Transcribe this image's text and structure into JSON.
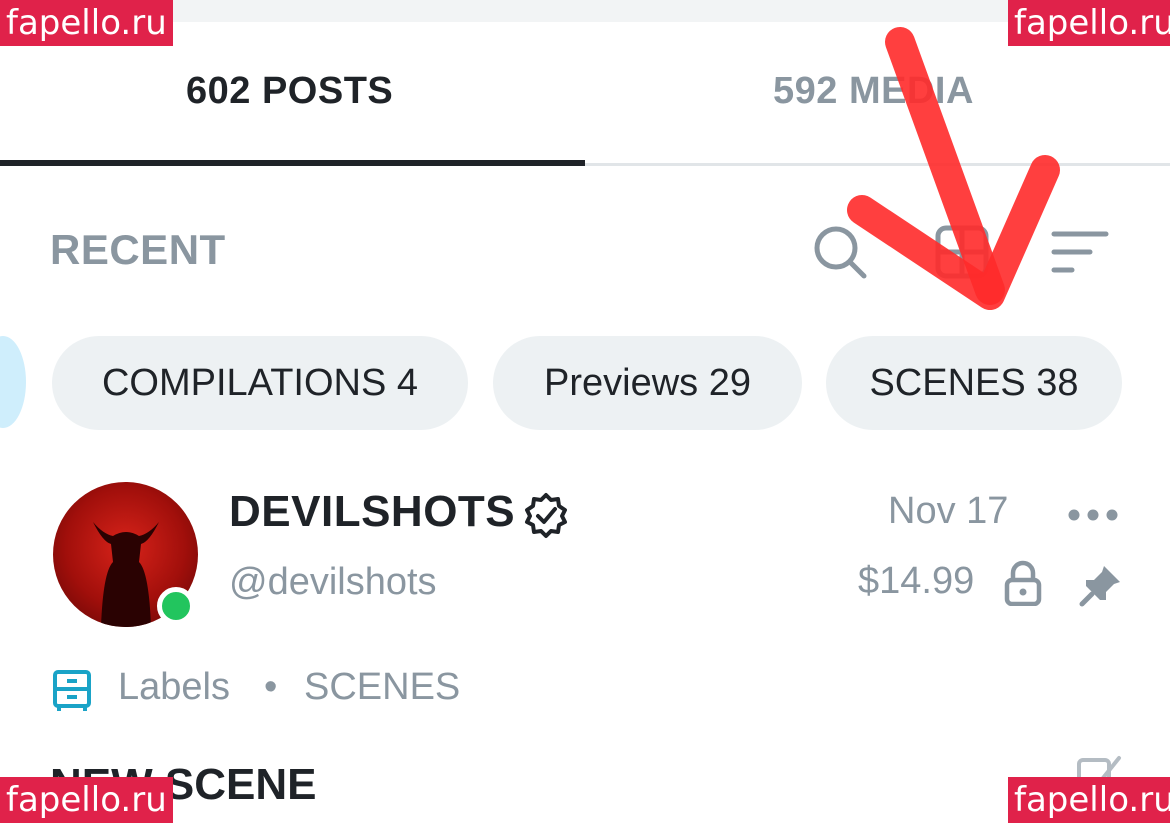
{
  "tabs": [
    {
      "label": "602 POSTS",
      "active": true
    },
    {
      "label": "592 MEDIA",
      "active": false
    }
  ],
  "section": {
    "title": "RECENT",
    "icons": [
      "search-icon",
      "grid-view-icon",
      "sort-icon"
    ]
  },
  "chips": [
    {
      "label": "COMPILATIONS 4"
    },
    {
      "label": "Previews 29"
    },
    {
      "label": "SCENES 38"
    }
  ],
  "post": {
    "author_name": "DEVILSHOTS",
    "handle": "@devilshots",
    "date": "Nov 17",
    "price": "$14.99",
    "labels_title": "Labels",
    "label_separator": "•",
    "label_value": "SCENES",
    "title": "NEW SCENE",
    "status": "online"
  },
  "watermark": "fapello.ru",
  "colors": {
    "text_primary": "#1f2328",
    "text_muted": "#8a96a0",
    "chip_bg": "#edf1f3",
    "online": "#22c55e",
    "labels_icon": "#1aa3c7",
    "watermark_bg": "#e0224a",
    "annotation": "#ff2a2a"
  }
}
